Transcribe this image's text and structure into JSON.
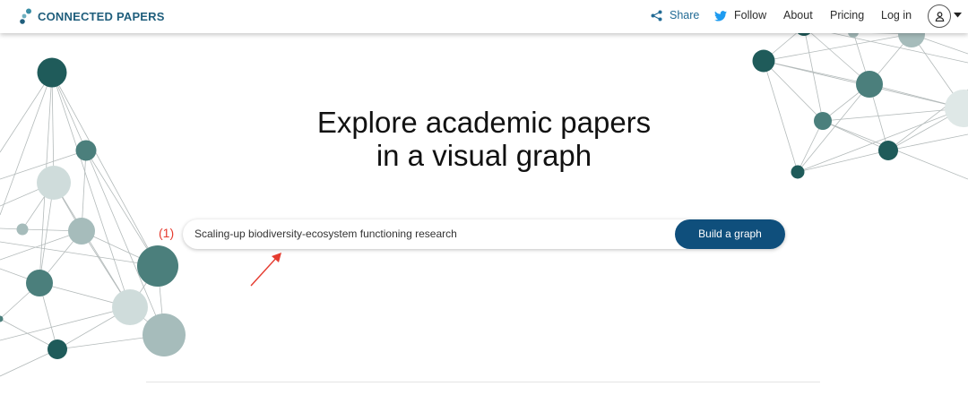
{
  "brand": {
    "name": "CONNECTED PAPERS",
    "logo_icon": "connected-dots-logo",
    "color": "#1f5e7c"
  },
  "nav": {
    "share": {
      "label": "Share",
      "icon": "share-icon"
    },
    "follow": {
      "label": "Follow",
      "icon": "twitter-bird-icon"
    },
    "about": "About",
    "pricing": "Pricing",
    "login": "Log in",
    "account_icon": "user-icon"
  },
  "hero": {
    "title_line1": "Explore academic papers",
    "title_line2": "in a visual graph"
  },
  "search": {
    "value": "Scaling‐up biodiversity‐ecosystem functioning research",
    "button_label": "Build a graph"
  },
  "annotation": {
    "label": "(1)",
    "color": "#e53b2f"
  },
  "colors": {
    "accent": "#0f4f7c",
    "node_dark": "#1f5b5a",
    "node_mid": "#4b7f7c",
    "node_light": "#cfdcdb"
  }
}
